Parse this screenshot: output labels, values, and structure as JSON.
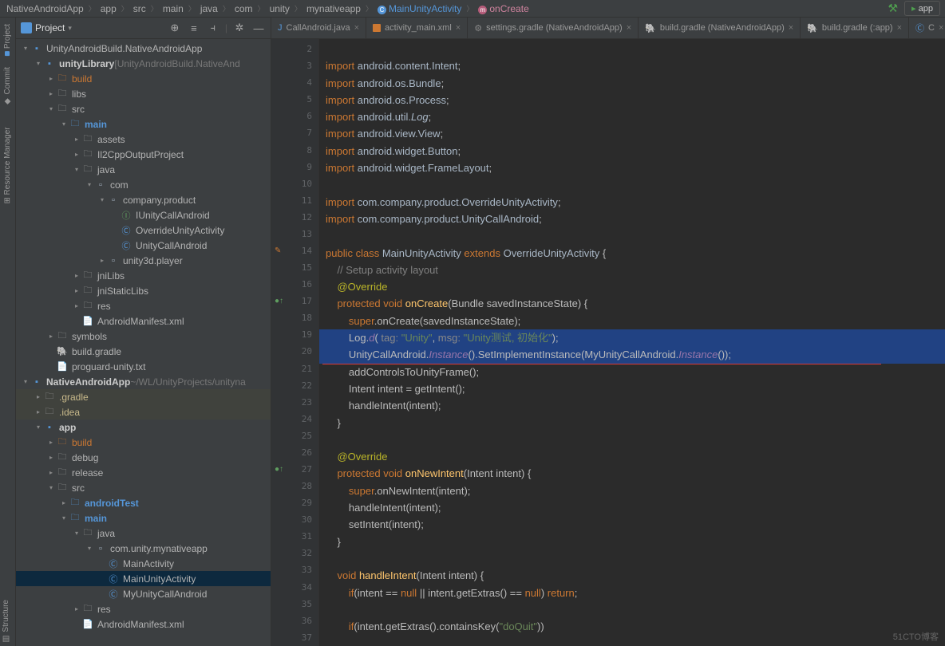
{
  "breadcrumbs": [
    "NativeAndroidApp",
    "app",
    "src",
    "main",
    "java",
    "com",
    "unity",
    "mynativeapp",
    "MainUnityActivity",
    "onCreate"
  ],
  "topRight": {
    "appBtn": "app"
  },
  "sidebarHead": {
    "title": "Project"
  },
  "leftbar": {
    "project": "Project",
    "commit": "Commit",
    "resource": "Resource Manager",
    "structure": "Structure"
  },
  "tree": [
    {
      "d": 0,
      "a": "v",
      "i": "mod",
      "t": "UnityAndroidBuild.NativeAndroidApp",
      "cls": ""
    },
    {
      "d": 1,
      "a": "v",
      "i": "mod",
      "t": "unityLibrary",
      "suf": "[UnityAndroidBuild.NativeAnd",
      "cls": "bold"
    },
    {
      "d": 2,
      "a": ">",
      "i": "folder",
      "t": "build",
      "cls": "orange"
    },
    {
      "d": 2,
      "a": ">",
      "i": "folder",
      "t": "libs"
    },
    {
      "d": 2,
      "a": "v",
      "i": "folder",
      "t": "src"
    },
    {
      "d": 3,
      "a": "v",
      "i": "src-f",
      "t": "main",
      "cls": "src-folder"
    },
    {
      "d": 4,
      "a": ">",
      "i": "folder",
      "t": "assets"
    },
    {
      "d": 4,
      "a": ">",
      "i": "folder",
      "t": "Il2CppOutputProject"
    },
    {
      "d": 4,
      "a": "v",
      "i": "folder",
      "t": "java"
    },
    {
      "d": 5,
      "a": "v",
      "i": "pkg",
      "t": "com"
    },
    {
      "d": 6,
      "a": "v",
      "i": "pkg",
      "t": "company.product"
    },
    {
      "d": 7,
      "a": "",
      "i": "interface-i",
      "t": "IUnityCallAndroid"
    },
    {
      "d": 7,
      "a": "",
      "i": "class-i",
      "t": "OverrideUnityActivity"
    },
    {
      "d": 7,
      "a": "",
      "i": "class-i",
      "t": "UnityCallAndroid"
    },
    {
      "d": 6,
      "a": ">",
      "i": "pkg",
      "t": "unity3d.player"
    },
    {
      "d": 4,
      "a": ">",
      "i": "folder",
      "t": "jniLibs"
    },
    {
      "d": 4,
      "a": ">",
      "i": "folder",
      "t": "jniStaticLibs"
    },
    {
      "d": 4,
      "a": ">",
      "i": "folder",
      "t": "res"
    },
    {
      "d": 4,
      "a": "",
      "i": "file",
      "t": "AndroidManifest.xml"
    },
    {
      "d": 2,
      "a": ">",
      "i": "folder",
      "t": "symbols"
    },
    {
      "d": 2,
      "a": "",
      "i": "gradle-i",
      "t": "build.gradle"
    },
    {
      "d": 2,
      "a": "",
      "i": "file",
      "t": "proguard-unity.txt"
    },
    {
      "d": 0,
      "a": "v",
      "i": "mod",
      "t": "NativeAndroidApp",
      "suf": "~/WL/UnityProjects/unityna",
      "cls": "bold"
    },
    {
      "d": 1,
      "a": ">",
      "i": "folder",
      "t": ".gradle",
      "cls": "gradle-root"
    },
    {
      "d": 1,
      "a": ">",
      "i": "folder",
      "t": ".idea",
      "cls": "gradle-root"
    },
    {
      "d": 1,
      "a": "v",
      "i": "mod",
      "t": "app",
      "cls": "bold"
    },
    {
      "d": 2,
      "a": ">",
      "i": "folder",
      "t": "build",
      "cls": "orange"
    },
    {
      "d": 2,
      "a": ">",
      "i": "folder",
      "t": "debug"
    },
    {
      "d": 2,
      "a": ">",
      "i": "folder",
      "t": "release"
    },
    {
      "d": 2,
      "a": "v",
      "i": "folder",
      "t": "src"
    },
    {
      "d": 3,
      "a": ">",
      "i": "src-f",
      "t": "androidTest",
      "cls": "src-folder"
    },
    {
      "d": 3,
      "a": "v",
      "i": "src-f",
      "t": "main",
      "cls": "src-folder"
    },
    {
      "d": 4,
      "a": "v",
      "i": "folder",
      "t": "java"
    },
    {
      "d": 5,
      "a": "v",
      "i": "pkg",
      "t": "com.unity.mynativeapp"
    },
    {
      "d": 6,
      "a": "",
      "i": "class-i",
      "t": "MainActivity"
    },
    {
      "d": 6,
      "a": "",
      "i": "class-i",
      "t": "MainUnityActivity",
      "cls": "sel"
    },
    {
      "d": 6,
      "a": "",
      "i": "class-i",
      "t": "MyUnityCallAndroid"
    },
    {
      "d": 4,
      "a": ">",
      "i": "folder",
      "t": "res"
    },
    {
      "d": 4,
      "a": "",
      "i": "file",
      "t": "AndroidManifest.xml"
    }
  ],
  "tabs": [
    {
      "icon": "java",
      "label": "CallAndroid.java"
    },
    {
      "icon": "xml",
      "label": "activity_main.xml"
    },
    {
      "icon": "gear",
      "label": "settings.gradle (NativeAndroidApp)"
    },
    {
      "icon": "ele",
      "label": "build.gradle (NativeAndroidApp)"
    },
    {
      "icon": "ele",
      "label": "build.gradle (:app)"
    },
    {
      "icon": "c",
      "label": "C"
    }
  ],
  "gutter": {
    "start": 2,
    "end": 37,
    "marks": {
      "14": "edit",
      "17": "impl",
      "27": "impl"
    }
  },
  "code": [
    "",
    "<span class='kw'>import</span> <span class='cls'>android.content.Intent</span>;",
    "<span class='kw'>import</span> <span class='cls'>android.os.Bundle</span>;",
    "<span class='kw'>import</span> <span class='cls'>android.os.Process</span>;",
    "<span class='kw'>import</span> <span class='cls'>android.util.</span><span class='stat'>Log</span>;",
    "<span class='kw'>import</span> <span class='cls'>android.view.View</span>;",
    "<span class='kw'>import</span> <span class='cls'>android.widget.Button</span>;",
    "<span class='kw'>import</span> <span class='cls'>android.widget.FrameLayout</span>;",
    "",
    "<span class='kw'>import</span> <span class='cls'>com.company.product.OverrideUnityActivity</span>;",
    "<span class='kw'>import</span> <span class='cls'>com.company.product.UnityCallAndroid</span>;",
    "",
    "<span class='kw'>public class</span> <span class='cls'>MainUnityActivity</span> <span class='kw'>extends</span> <span class='cls'>OverrideUnityActivity</span> {",
    "    <span class='com'>// Setup activity layout</span>",
    "    <span class='ann'>@Override</span>",
    "    <span class='kw'>protected void</span> <span class='fn'>onCreate</span>(Bundle savedInstanceState) {",
    "        <span class='kw'>super</span>.onCreate(savedInstanceState);",
    "        Log.<span class='stat-m'>d</span>( <span class='param'>tag:</span> <span class='str'>\"Unity\"</span>, <span class='param'>msg:</span> <span class='str'>\"Unity测试, 初始化\"</span>);",
    "        UnityCallAndroid.<span class='stat-m'>Instance</span>().SetImplementInstance(MyUnityCallAndroid.<span class='stat-m'>Instance</span>());",
    "        addControlsToUnityFrame();",
    "        Intent intent = getIntent();",
    "        handleIntent(intent);",
    "    }",
    "",
    "    <span class='ann'>@Override</span>",
    "    <span class='kw'>protected void</span> <span class='fn'>onNewIntent</span>(Intent intent) {",
    "        <span class='kw'>super</span>.onNewIntent(intent);",
    "        handleIntent(intent);",
    "        setIntent(intent);",
    "    }",
    "",
    "    <span class='kw'>void</span> <span class='fn'>handleIntent</span>(Intent intent) {",
    "        <span class='kw'>if</span>(intent == <span class='kw'>null</span> || intent.getExtras() == <span class='kw'>null</span>) <span class='kw'>return</span>;",
    "",
    "        <span class='kw'>if</span>(intent.getExtras().containsKey(<span class='str'>\"doQuit\"</span>))"
  ],
  "highlightLines": [
    18,
    19
  ],
  "watermark": "51CTO博客"
}
